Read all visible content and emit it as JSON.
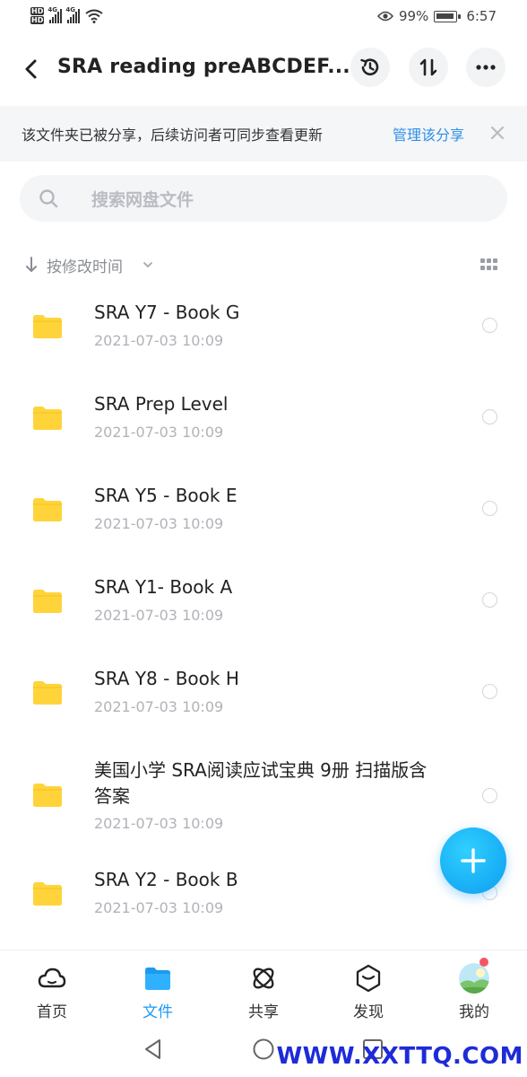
{
  "status_bar": {
    "battery_percent": "99%",
    "time": "6:57",
    "network_labels": [
      "4G",
      "4G"
    ],
    "hd_labels": [
      "HD",
      "HD"
    ]
  },
  "header": {
    "title": "SRA reading preABCDEF...",
    "icons": [
      "back-arrow-icon",
      "history-icon",
      "sort-transfer-icon",
      "more-icon"
    ]
  },
  "notice": {
    "text": "该文件夹已被分享，后续访问者可同步查看更新",
    "link": "管理该分享"
  },
  "search": {
    "placeholder": "搜索网盘文件"
  },
  "sort": {
    "label": "按修改时间"
  },
  "files": [
    {
      "name": "SRA Y7 - Book G",
      "date": "2021-07-03  10:09"
    },
    {
      "name": "SRA Prep Level",
      "date": "2021-07-03  10:09"
    },
    {
      "name": "SRA Y5 - Book E",
      "date": "2021-07-03  10:09"
    },
    {
      "name": "SRA Y1- Book A",
      "date": "2021-07-03  10:09"
    },
    {
      "name": "SRA Y8 - Book H",
      "date": "2021-07-03  10:09"
    },
    {
      "name_line1": "美国小学 SRA阅读应试宝典 9册 扫描版含",
      "name_line2": "答案",
      "date": "2021-07-03  10:09"
    },
    {
      "name": "SRA Y2 - Book B",
      "date": "2021-07-03  10:09"
    }
  ],
  "tabs": [
    {
      "label": "首页",
      "icon": "cloud-icon"
    },
    {
      "label": "文件",
      "icon": "folder-icon",
      "active": true
    },
    {
      "label": "共享",
      "icon": "orbit-share-icon"
    },
    {
      "label": "发现",
      "icon": "cube-discover-icon"
    },
    {
      "label": "我的",
      "icon": "avatar-icon"
    }
  ],
  "watermark": "WWW.XXTTQ.COM",
  "colors": {
    "accent": "#1c9af0",
    "folder": "#ffd43b",
    "link": "#2e8fe8",
    "badge": "#f45566",
    "watermark": "#1e2bd8"
  }
}
